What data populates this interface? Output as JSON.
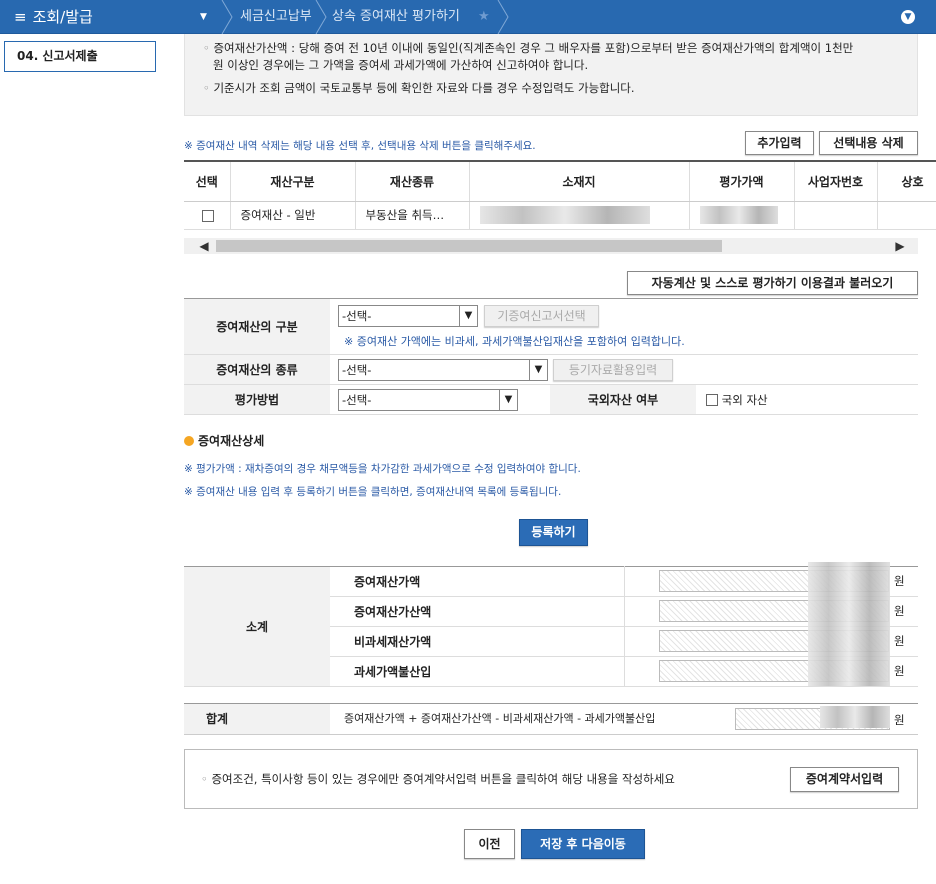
{
  "topbar": {
    "menu_title": "조회/발급",
    "breadcrumb": [
      "세금신고납부",
      "상속 증여재산 평가하기"
    ]
  },
  "sidebar": {
    "item": "04. 신고서제출"
  },
  "info": {
    "line1a": "증여재산가산액 : 당해 증여 전 10년 이내에 동일인(직계존속인 경우 그 배우자를 포함)으로부터 받은 증여재산가액의 합계액이 1천만",
    "line1b": "원 이상인 경우에는 그 가액을 증여세 과세가액에 가산하여 신고하여야 합니다.",
    "line2": "기준시가 조회 금액이 국토교통부 등에 확인한 자료와 다를 경우 수정입력도 가능합니다."
  },
  "list": {
    "note": "※ 증여재산 내역 삭제는 해당 내용 선택 후, 선택내용 삭제 버튼을  클릭해주세요.",
    "add_button": "추가입력",
    "delete_button": "선택내용 삭제",
    "columns": [
      "선택",
      "재산구분",
      "재산종류",
      "소재지",
      "평가가액",
      "사업자번호",
      "상호"
    ],
    "rows": [
      {
        "category": "증여재산 - 일반",
        "kind": "부동산을 취득…"
      }
    ]
  },
  "autocalc_button": "자동계산 및 스스로 평가하기 이용결과 불러오기",
  "form": {
    "type_label": "증여재산의 구분",
    "type_value": "-선택-",
    "prev_report_button": "기증여신고서선택",
    "type_note": "※ 증여재산 가액에는 비과세, 과세가액불산입재산을 포함하여 입력합니다.",
    "kind_label": "증여재산의 종류",
    "kind_value": "-선택-",
    "registry_button": "등기자료활용입력",
    "method_label": "평가방법",
    "method_value": "-선택-",
    "foreign_label": "국외자산 여부",
    "foreign_checkbox": "국외 자산"
  },
  "detail": {
    "title": "증여재산상세",
    "note1": "※ 평가가액 : 재차증여의 경우 채무액등을 차가감한 과세가액으로 수정 입력하여야 합니다.",
    "note2": "※ 증여재산 내용 입력 후 등록하기 버튼을 클릭하면, 증여재산내역 목록에 등록됩니다.",
    "register_button": "등록하기"
  },
  "summary": {
    "subtotal_label": "소계",
    "rows": [
      "증여재산가액",
      "증여재산가산액",
      "비과세재산가액",
      "과세가액불산입"
    ],
    "unit": "원",
    "total_label": "합계",
    "total_formula": "증여재산가액 + 증여재산가산액 - 비과세재산가액 - 과세가액불산입"
  },
  "contract": {
    "note": "증여조건, 특이사항 등이 있는 경우에만 증여계약서입력 버튼을 클릭하여 해당 내용을 작성하세요",
    "button": "증여계약서입력"
  },
  "nav": {
    "prev": "이전",
    "next": "저장 후 다음이동"
  },
  "colors": {
    "header_blue": "#2869b0",
    "note_blue": "#2a5aa6",
    "button_blue": "#2b6cb6"
  }
}
